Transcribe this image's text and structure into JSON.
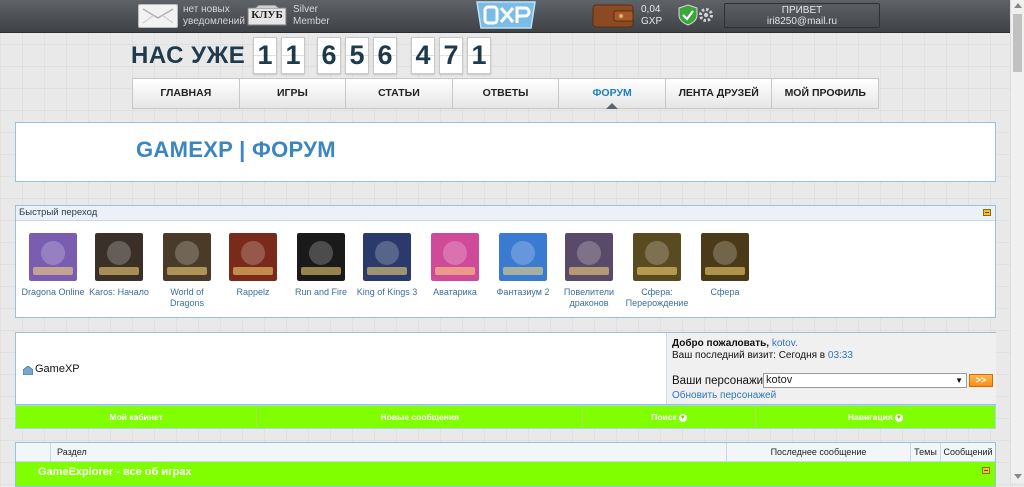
{
  "topbar": {
    "notifications_line1": "нет новых",
    "notifications_line2": "уведомлений",
    "club_label": "КЛУБ",
    "member_line1": "Silver",
    "member_line2": "Member",
    "balance_value": "0,04",
    "balance_currency": "GXP",
    "greeting": "ПРИВЕТ",
    "user_email": "iri8250@mail.ru"
  },
  "counter": {
    "label": "НАС УЖЕ",
    "digits": [
      "1",
      "1",
      "6",
      "5",
      "6",
      "4",
      "7",
      "1"
    ]
  },
  "nav": {
    "items": [
      "ГЛАВНАЯ",
      "ИГРЫ",
      "СТАТЬИ",
      "ОТВЕТЫ",
      "ФОРУМ",
      "ЛЕНТА ДРУЗЕЙ",
      "МОЙ ПРОФИЛЬ"
    ],
    "active": "ФОРУМ"
  },
  "page_title": "GAMEXP | ФОРУМ",
  "quick_jump": {
    "title": "Быстрый переход",
    "games": [
      {
        "line1": "Dragona Online",
        "line2": "",
        "color": "#7a5db0"
      },
      {
        "line1": "Karos: Начало",
        "line2": "",
        "color": "#3a3028"
      },
      {
        "line1": "World of",
        "line2": "Dragons",
        "color": "#4a3a2a"
      },
      {
        "line1": "Rappelz",
        "line2": "",
        "color": "#7a2a1a"
      },
      {
        "line1": "Run and Fire",
        "line2": "",
        "color": "#1a1a1a"
      },
      {
        "line1": "King of Kings 3",
        "line2": "",
        "color": "#2a3a6a"
      },
      {
        "line1": "Аватарика",
        "line2": "",
        "color": "#d04a9a"
      },
      {
        "line1": "Фантазиум 2",
        "line2": "",
        "color": "#3a7ad0"
      },
      {
        "line1": "Повелители",
        "line2": "драконов",
        "color": "#5a4a6a"
      },
      {
        "line1": "Сфера:",
        "line2": "Перерождение",
        "color": "#5a4a20"
      },
      {
        "line1": "Сфера",
        "line2": "",
        "color": "#4a3a18"
      }
    ]
  },
  "welcome": {
    "site_name": "GameXP",
    "welcome_prefix": "Добро пожаловать,",
    "username": "kotov.",
    "last_visit_prefix": "Ваш последний визит: Сегодня в",
    "last_visit_time": "03:33",
    "characters_label": "Ваши персонажи:",
    "selected_character": "kotov",
    "go_label": ">>",
    "refresh_link": "Обновить персонажей"
  },
  "forum_nav": {
    "items": [
      "Мой кабинет",
      "Новые сообщения",
      "Поиск",
      "Навигация"
    ]
  },
  "forum_table": {
    "headers": {
      "section": "Раздел",
      "last_post": "Последнее сообщение",
      "topics": "Темы",
      "posts": "Сообщений"
    },
    "category": "GameExplorer - все об играх"
  }
}
